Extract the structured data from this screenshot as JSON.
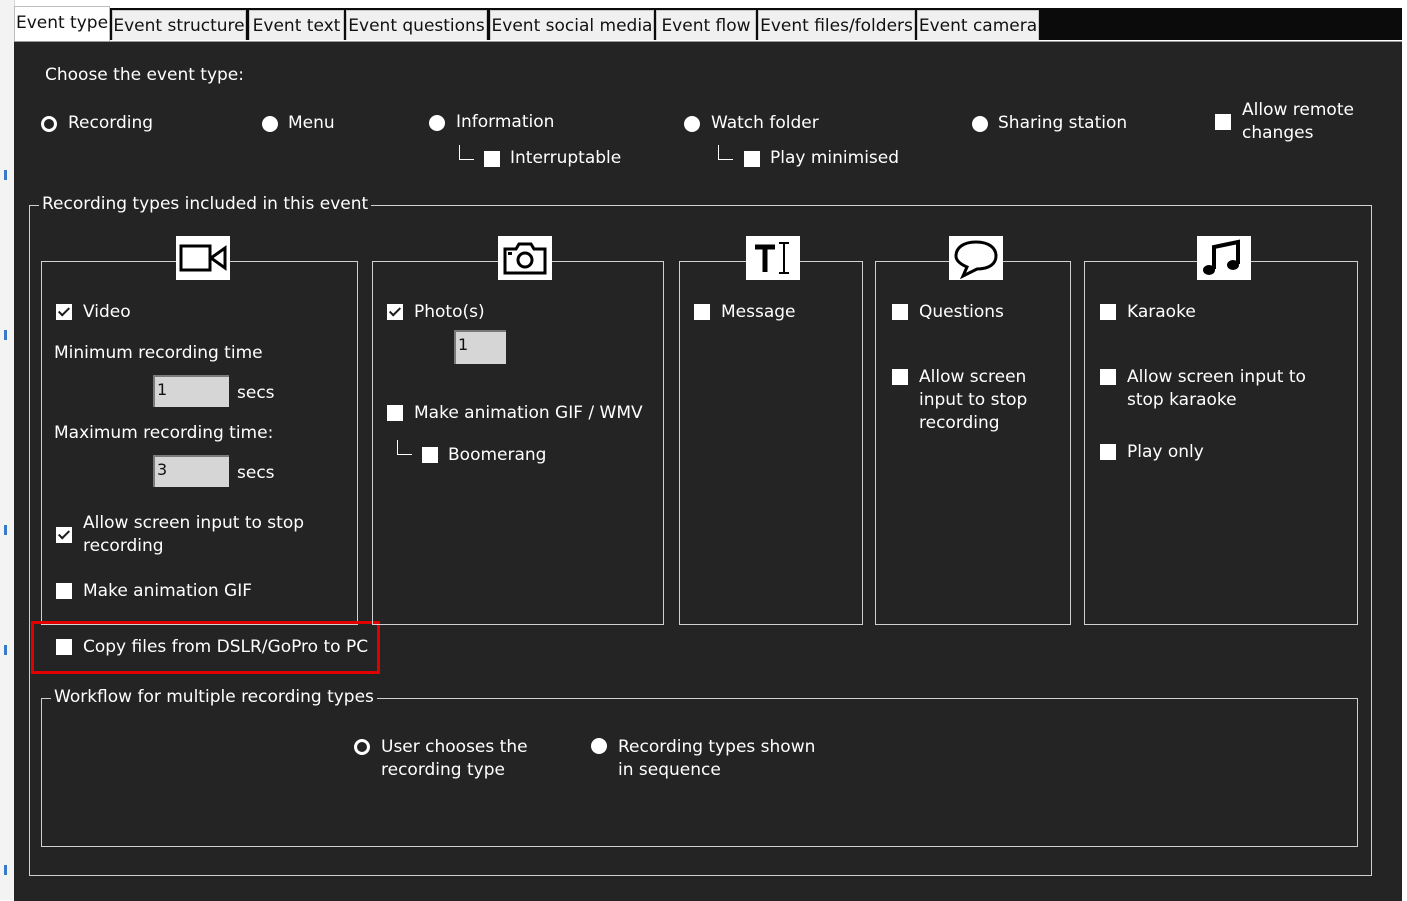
{
  "tabs": [
    "Event type",
    "Event structure",
    "Event text",
    "Event questions",
    "Event social media",
    "Event flow",
    "Event files/folders",
    "Event camera"
  ],
  "event_type": {
    "prompt": "Choose the event type:",
    "options": [
      "Recording",
      "Menu",
      "Information",
      "Watch folder",
      "Sharing station"
    ],
    "selected": "Recording",
    "interruptable_label": "Interruptable",
    "play_minimised_label": "Play minimised",
    "allow_remote_label_line1": "Allow remote",
    "allow_remote_label_line2": "changes"
  },
  "recording_group": {
    "title": "Recording types included in this event",
    "video": {
      "icon": "video-camera-icon",
      "label": "Video",
      "checked": true,
      "min_label": "Minimum recording time",
      "min_value": "1",
      "max_label": "Maximum recording time:",
      "max_value": "3",
      "secs": "secs",
      "allow_stop_line1": "Allow screen input to stop",
      "allow_stop_line2": "recording",
      "allow_stop_checked": true,
      "gif_label": "Make animation GIF"
    },
    "copy_files_label": "Copy files from DSLR/GoPro to PC",
    "photo": {
      "icon": "photo-camera-icon",
      "label": "Photo(s)",
      "checked": true,
      "count_value": "1",
      "animation_label": "Make animation GIF / WMV",
      "boomerang_label": "Boomerang"
    },
    "message": {
      "icon": "text-icon",
      "label": "Message"
    },
    "questions": {
      "icon": "speech-bubble-icon",
      "label": "Questions",
      "allow_line1": "Allow screen",
      "allow_line2": "input to stop",
      "allow_line3": "recording"
    },
    "karaoke": {
      "icon": "music-note-icon",
      "label": "Karaoke",
      "allow_line1": "Allow screen input to",
      "allow_line2": "stop karaoke",
      "play_only_label": "Play only"
    }
  },
  "workflow": {
    "title": "Workflow for multiple recording types",
    "option1_line1": "User chooses the",
    "option1_line2": "recording type",
    "option2_line1": "Recording types shown",
    "option2_line2": "in sequence",
    "selected": "User chooses the recording type"
  },
  "colors": {
    "panel_bg": "#242424",
    "highlight": "#e00000"
  }
}
